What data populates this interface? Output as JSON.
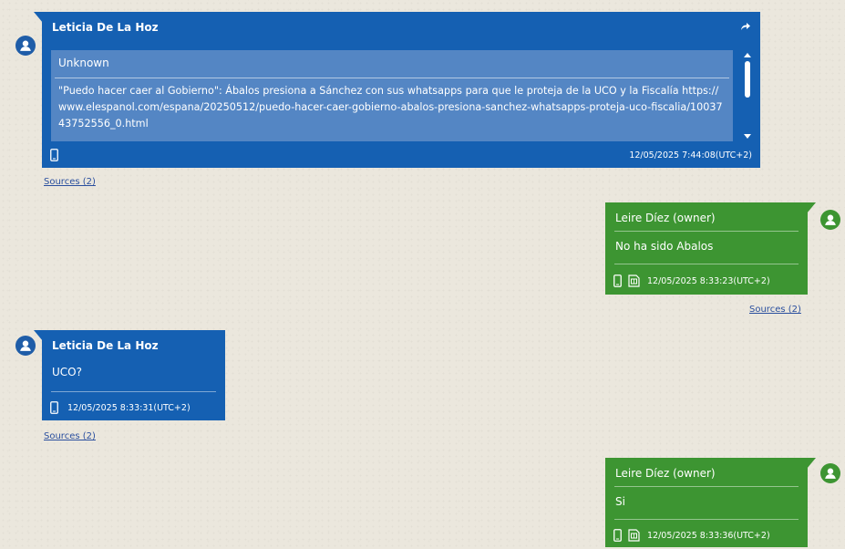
{
  "messages": [
    {
      "sender": "Leticia De La Hoz",
      "quoted_card": {
        "title": "Unknown",
        "text": "\"Puedo hacer caer al Gobierno\": Ábalos presiona a Sánchez con sus whatsapps para que le proteja de la UCO y la Fiscalía https://www.elespanol.com/espana/20250512/puedo-hacer-caer-gobierno-abalos-presiona-sanchez-whatsapps-proteja-uco-fiscalia/1003743752556_0.html"
      },
      "timestamp": "12/05/2025 7:44:08(UTC+2)",
      "sources": "Sources (2)"
    },
    {
      "sender": "Leire Díez (owner)",
      "text": "No ha sido Abalos",
      "timestamp": "12/05/2025 8:33:23(UTC+2)",
      "sources": "Sources (2)"
    },
    {
      "sender": "Leticia De La Hoz",
      "text": "UCO?",
      "timestamp": "12/05/2025 8:33:31(UTC+2)",
      "sources": "Sources (2)"
    },
    {
      "sender": "Leire Díez (owner)",
      "text": "Si",
      "timestamp": "12/05/2025 8:33:36(UTC+2)"
    }
  ],
  "icons": {
    "avatar": "user-icon",
    "phone": "phone-icon",
    "sim": "sim-card-icon",
    "share": "share-icon"
  },
  "colors": {
    "incoming": "#1560b2",
    "outgoing": "#3d9532",
    "card": "#5486c4",
    "link": "#2a4f9e"
  }
}
